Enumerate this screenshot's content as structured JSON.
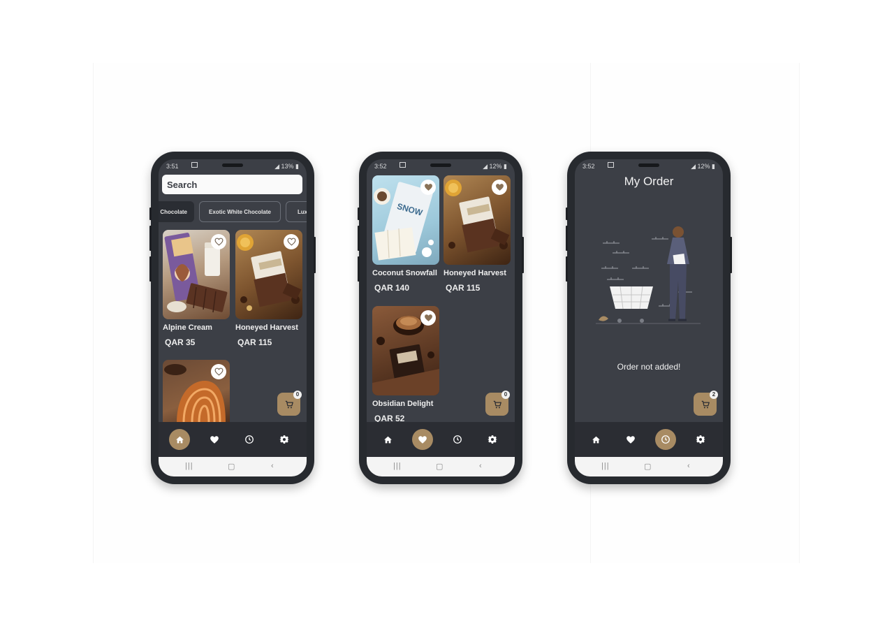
{
  "colors": {
    "accent": "#a88b63",
    "screen_bg": "#3c3f46",
    "nav_bg": "#2b2d33",
    "frame": "#272a2f"
  },
  "icons": {
    "home": "home-icon",
    "favorites": "heart-icon",
    "orders": "clock-icon",
    "settings": "gear-icon",
    "cart": "cart-icon",
    "favorite_toggle": "heart-outline-icon"
  },
  "phones": [
    {
      "status": {
        "time": "3:51",
        "battery": "13%"
      },
      "search": {
        "placeholder": "Search"
      },
      "categories": [
        "Chocolate",
        "Exotic White Chocolate",
        "Lux"
      ],
      "products": [
        {
          "name": "Alpine Cream",
          "price": "QAR 35"
        },
        {
          "name": "Honeyed Harvest",
          "price": "QAR 115"
        }
      ],
      "cart_count": "0",
      "active_tab": "home"
    },
    {
      "status": {
        "time": "3:52",
        "battery": "12%"
      },
      "favorites": [
        {
          "name": "Coconut Snowfall",
          "price": "QAR 140"
        },
        {
          "name": "Honeyed Harvest",
          "price": "QAR 115"
        },
        {
          "name": "Obsidian Delight",
          "price": "QAR 52"
        }
      ],
      "cart_count": "0",
      "active_tab": "favorites"
    },
    {
      "status": {
        "time": "3:52",
        "battery": "12%"
      },
      "title": "My Order",
      "empty_message": "Order not added!",
      "cart_count": "2",
      "active_tab": "orders"
    }
  ]
}
